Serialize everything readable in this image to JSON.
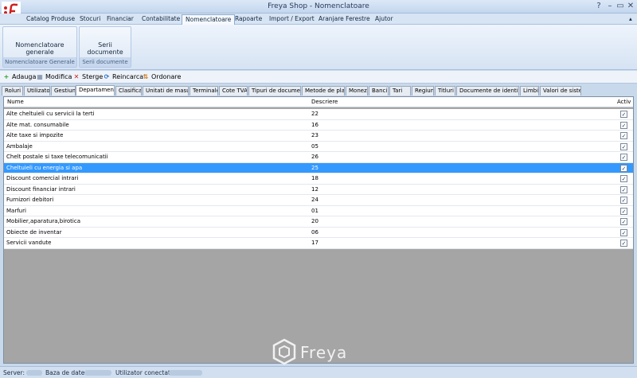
{
  "window": {
    "title": "Freya Shop - Nomenclatoare"
  },
  "menu": [
    "Catalog Produse",
    "Stocuri",
    "Financiar",
    "Contabilitate",
    "Nomenclatoare",
    "Rapoarte",
    "Import / Export",
    "Aranjare Ferestre",
    "Ajutor"
  ],
  "ribbon": {
    "groups": [
      {
        "button": "Nomenclatoare generale",
        "label": "Nomenclatoare Generale"
      },
      {
        "button": "Serii documente",
        "label": "Serii documente"
      }
    ]
  },
  "toolbar": {
    "add": "Adauga",
    "edit": "Modifica",
    "delete": "Sterge",
    "reload": "Reincarca",
    "order": "Ordonare"
  },
  "tabs": [
    "Roluri",
    "Utilizatori",
    "Gestiuni",
    "Departamente",
    "Clasificari",
    "Unitati de masura",
    "Terminale",
    "Cote TVA",
    "Tipuri de documente",
    "Metode de plata",
    "Monezi",
    "Banci",
    "Tari",
    "Regiuni",
    "Titluri",
    "Documente de identitate",
    "Limbi",
    "Valori de sistem"
  ],
  "grid": {
    "columns": [
      "Nume",
      "Descriere",
      "Activ"
    ],
    "rows": [
      {
        "nume": "Alte cheltuieli cu servicii la terti",
        "descriere": "22",
        "activ": "✓"
      },
      {
        "nume": "Alte mat. consumabile",
        "descriere": "16",
        "activ": "✓"
      },
      {
        "nume": "Alte taxe si impozite",
        "descriere": "23",
        "activ": "✓"
      },
      {
        "nume": "Ambalaje",
        "descriere": "05",
        "activ": "✓"
      },
      {
        "nume": "Chelt postale si taxe telecomunicatii",
        "descriere": "26",
        "activ": "✓"
      },
      {
        "nume": "Cheltuieli cu energia si apa",
        "descriere": "25",
        "activ": "✓"
      },
      {
        "nume": "Discount comercial intrari",
        "descriere": "18",
        "activ": "✓"
      },
      {
        "nume": "Discount financiar intrari",
        "descriere": "12",
        "activ": "✓"
      },
      {
        "nume": "Furnizori debitori",
        "descriere": "24",
        "activ": "✓"
      },
      {
        "nume": "Marfuri",
        "descriere": "01",
        "activ": "✓"
      },
      {
        "nume": "Mobilier,aparatura,birotica",
        "descriere": "20",
        "activ": "✓"
      },
      {
        "nume": "Obiecte de inventar",
        "descriere": "06",
        "activ": "✓"
      },
      {
        "nume": "Servicii vandute",
        "descriere": "17",
        "activ": "✓"
      }
    ]
  },
  "watermark": "Freya",
  "status": {
    "server": "Server:",
    "db": "Baza de date:",
    "user": "Utilizator conectat:"
  },
  "colors": {
    "selection": "#3399ff",
    "accent": "#d7e4f4"
  }
}
